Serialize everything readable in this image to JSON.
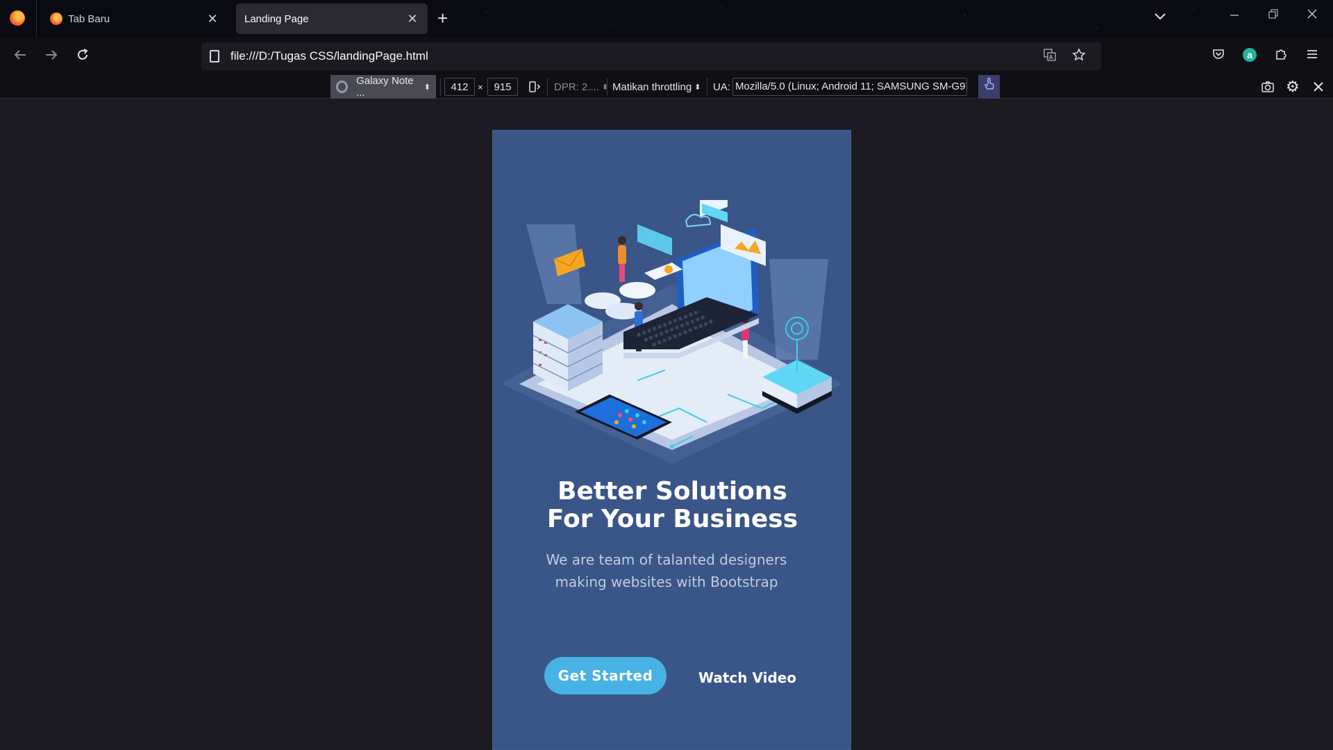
{
  "tabs": [
    {
      "title": "Tab Baru",
      "active": false
    },
    {
      "title": "Landing Page",
      "active": true
    }
  ],
  "tab_close_glyph": "✕",
  "new_tab_glyph": "+",
  "url": "file:///D:/Tugas CSS/landingPage.html",
  "rdm": {
    "device": "Galaxy Note ...",
    "width": "412",
    "times": "×",
    "height": "915",
    "dpr": "DPR: 2....",
    "throttling": "Matikan throttling",
    "ua_label": "UA:",
    "ua_value": "Mozilla/5.0 (Linux; Android 11; SAMSUNG SM-G97"
  },
  "page": {
    "title": "Better Solutions For Your Business",
    "subtitle": "We are team of talanted designers making websites with Bootstrap",
    "primary_button": "Get Started",
    "secondary_button": "Watch Video",
    "bg_color": "#3a5587",
    "accent_color": "#47b2e4"
  },
  "icons": {
    "back": "arrow-left-icon",
    "forward": "arrow-right-icon",
    "reload": "reload-icon",
    "translate": "translate-icon",
    "bookmark": "star-icon",
    "pocket": "pocket-icon",
    "account": "account-icon",
    "extensions": "puzzle-icon",
    "menu": "hamburger-menu-icon",
    "screenshot": "camera-icon",
    "settings": "gear-icon",
    "close_rdm": "close-icon"
  },
  "account_letter": "a"
}
